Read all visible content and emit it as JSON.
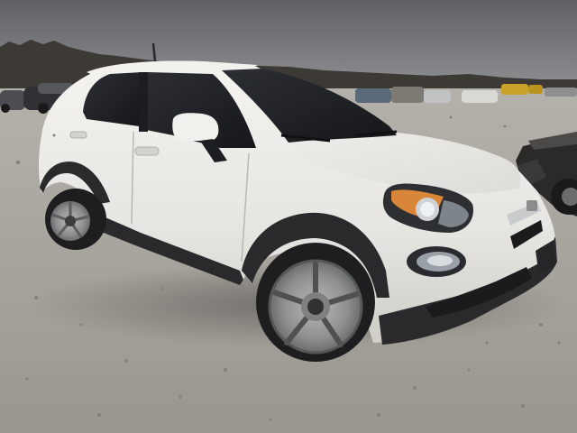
{
  "photo": {
    "colors": {
      "sky": "#6f7175",
      "sky_horizon": "#8d8f92",
      "tree_line": "#3b3835",
      "gravel": "#a8a49f",
      "gravel_dark": "#8e8a85",
      "car_body": "#ecebe7",
      "car_shadow_body": "#cfcdc8",
      "trim_black": "#2a2a2c",
      "glass": "#1d1f23",
      "wheel_silver": "#9fa1a3",
      "tire": "#1e1e20",
      "salvage_car": "#2b2a29",
      "distant_car_yellow": "#c9a227"
    }
  }
}
